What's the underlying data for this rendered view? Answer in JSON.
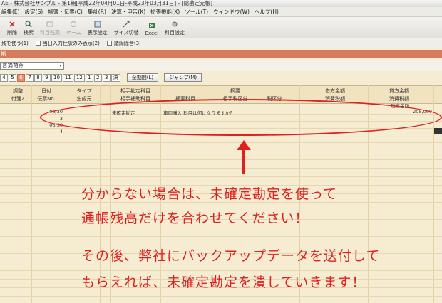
{
  "window": {
    "title": "AE - 株式会社サンプル - 第1期[平成22年04月01日-平成23年03月31日] - [総勘定元帳]"
  },
  "menu": [
    "編集(E)",
    "設定(S)",
    "帳簿・伝票(C)",
    "集計(R)",
    "決算・申告(K)",
    "拡張機能(X)",
    "ツール(T)",
    "ウィンドウ(W)",
    "ヘルプ(H)"
  ],
  "toolbar": [
    {
      "label": "削除",
      "icon": "delete-icon"
    },
    {
      "label": "検索",
      "icon": "search-icon"
    },
    {
      "label": "科目残高",
      "icon": "balance-icon",
      "disabled": true
    },
    {
      "label": "ゲーム",
      "icon": "game-icon",
      "disabled": true
    },
    {
      "label": "表示設定",
      "icon": "display-settings-icon"
    },
    {
      "label": "サイズ切替",
      "icon": "resize-icon"
    },
    {
      "label": "Excel",
      "icon": "excel-icon"
    },
    {
      "label": "科目設定",
      "icon": "account-settings-icon"
    }
  ],
  "options": {
    "opt1": "残を使う(1)",
    "opt2": "当日入力仕訳のみ表示(2)",
    "opt3": "諸締除合(3)"
  },
  "section_title": "帳",
  "account": {
    "value": "普通預金"
  },
  "months": [
    "4",
    "5",
    "6",
    "7",
    "8",
    "9",
    "10",
    "11",
    "12",
    "1",
    "2",
    "3",
    "決"
  ],
  "active_month": "6",
  "buttons": {
    "all_period": "全期間(L)",
    "jump": "ジャンプ(M)"
  },
  "header": {
    "col_adjust": "調整",
    "col_adjust2": "付箋2",
    "col_date": "日付",
    "col_voucher": "伝票No.",
    "col_type": "タイプ",
    "col_origin": "生成元",
    "col_counter": "相手勘定科目",
    "col_counter_sub": "相手補助科目",
    "col_desc": "摘要",
    "col_desc_sub1": "摘要科目",
    "col_desc_sub2": "相手税区分",
    "col_desc_sub3": "税区分",
    "col_debit": "借方金額",
    "col_debit_tax": "消費税額",
    "col_credit": "貸方金額",
    "col_credit_tax": "消費税額",
    "col_balance": "残高金額"
  },
  "rows": [
    {
      "date": "06/30",
      "no": "3",
      "counter": "未確定勘定",
      "desc": "車両購入  科目は何になりますか？",
      "credit": "205,000"
    },
    {
      "date": "06/30",
      "no": "4"
    }
  ],
  "annotation": {
    "line1": "分からない場合は、未確定勘定を使って",
    "line2": "通帳残高だけを合わせてください！",
    "line3": "その後、弊社にバックアップデータを送付して",
    "line4": "もらえれば、未確定勘定を潰していきます！",
    "color": "#e02020"
  }
}
